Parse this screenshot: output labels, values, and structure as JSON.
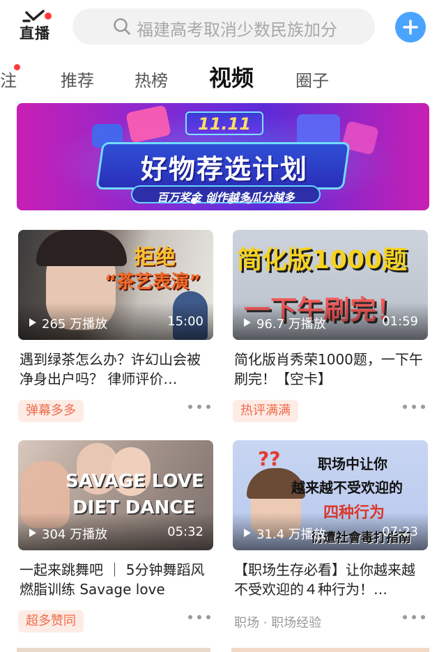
{
  "header": {
    "logo_text": "直播",
    "search_placeholder": "福建高考取消少数民族加分"
  },
  "tabs": [
    "注",
    "推荐",
    "热榜",
    "视频",
    "圈子"
  ],
  "active_tab": "视频",
  "banner": {
    "date": "11.11",
    "title": "好物荐选计划",
    "subtitle": "百万奖金 创作越多瓜分越多",
    "pages": 4,
    "current_page": 1
  },
  "cards": [
    {
      "overlay": [
        "拒绝",
        "“茶艺表演”"
      ],
      "views": "265 万播放",
      "duration": "15:00",
      "title": "遇到绿茶怎么办？许幻山会被净身出户吗？ 律师评价…",
      "tag": "弹幕多多"
    },
    {
      "overlay": [
        "简化版1000题",
        "一下午刷完！"
      ],
      "views": "96.7 万播放",
      "duration": "01:59",
      "title": "简化版肖秀荣1000题，一下午刷完！【空卡】",
      "tag": "热评满满"
    },
    {
      "overlay": [
        "SAVAGE LOVE",
        "DIET DANCE"
      ],
      "views": "304 万播放",
      "duration": "05:32",
      "title": "一起来跳舞吧 ｜ 5分钟舞蹈风燃脂训练 Savage love",
      "tag": "超多赞同"
    },
    {
      "overlay": [
        "??",
        "职场中让你",
        "越来越不受欢迎的",
        "四种行为",
        "衍遭社會毒打指南"
      ],
      "views": "31.4 万播放",
      "duration": "07:23",
      "title": "【职场生存必看】让你越来越不受欢迎的４种行为！…",
      "meta": "职场 · 职场经验"
    }
  ],
  "colors": {
    "accent_blue": "#4aa3ff",
    "badge_red": "#ff3b3b",
    "tag_text": "#f06a4a",
    "tag_bg": "#fdece6"
  },
  "icons": [
    "tv-logo-icon",
    "search-icon",
    "plus-icon",
    "play-icon",
    "more-dots-icon"
  ]
}
